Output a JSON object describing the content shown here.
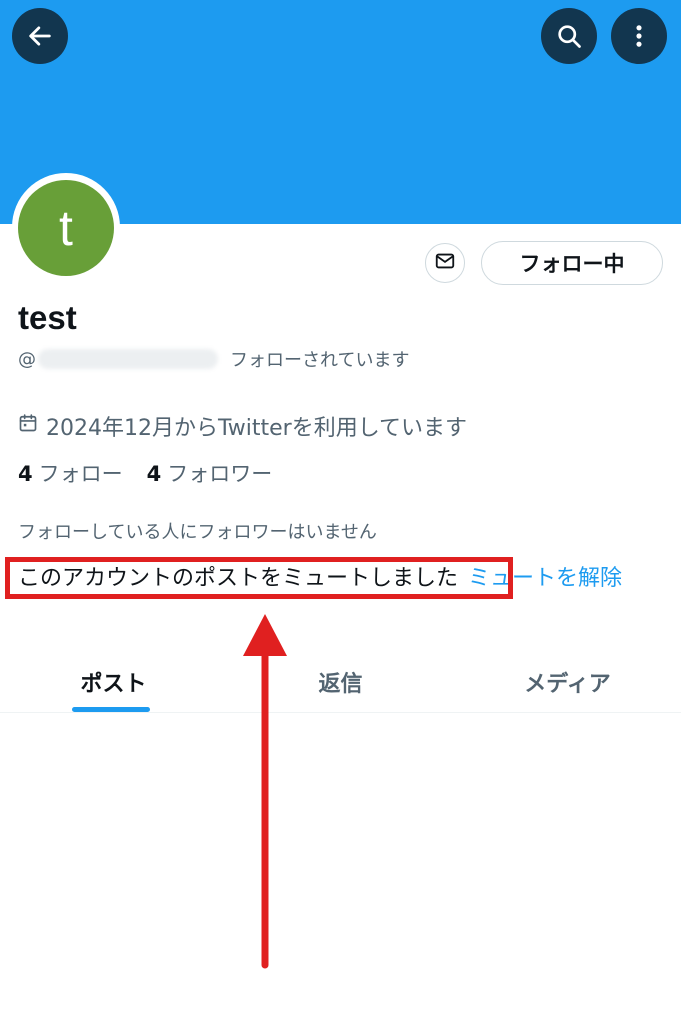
{
  "header": {
    "back_icon": "arrow-left-icon",
    "search_icon": "search-icon",
    "more_icon": "more-vertical-icon",
    "banner_color": "#1d9bf0"
  },
  "profile": {
    "avatar_letter": "t",
    "avatar_color": "#689f38",
    "name": "test",
    "handle_prefix": "@",
    "follows_you_label": "フォローされています",
    "joined": "2024年12月からTwitterを利用しています",
    "following_count": "4",
    "following_label": "フォロー",
    "followers_count": "4",
    "followers_label": "フォロワー",
    "no_known_followers": "フォローしている人にフォロワーはいません",
    "muted_notice": "このアカウントのポストをミュートしました",
    "unmute_link": "ミュートを解除"
  },
  "actions": {
    "message_icon": "mail-icon",
    "follow_button_label": "フォロー中"
  },
  "tabs": [
    {
      "label": "ポスト",
      "active": true
    },
    {
      "label": "返信",
      "active": false
    },
    {
      "label": "メディア",
      "active": false
    }
  ],
  "annotation": {
    "highlight_color": "#e02020"
  }
}
